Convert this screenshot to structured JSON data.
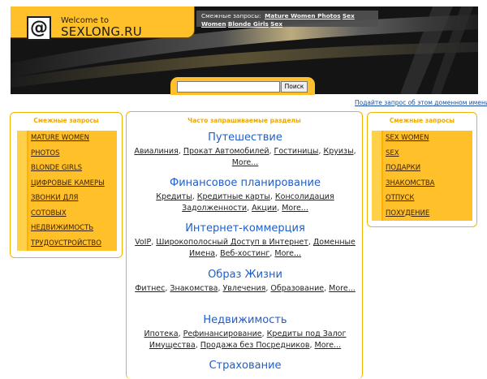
{
  "logo": {
    "welcome": "Welcome to",
    "site": "SEXLONG.RU",
    "icon": "at-icon"
  },
  "related_top": {
    "label": "Смежные запросы:",
    "links": [
      "Mature Women Photos",
      "Sex Women",
      "Blonde Girls",
      "Sex"
    ]
  },
  "search": {
    "value": "",
    "button": "Поиск"
  },
  "suggest_link": "Подайте запрос об этом доменном имени на",
  "left_panel": {
    "title": "Смежные запросы",
    "items": [
      "MATURE WOMEN",
      "PHOTOS",
      "BLONDE GIRLS",
      "ЦИФРОВЫЕ КАМЕРЫ",
      "ЗВОНКИ ДЛЯ",
      "СОТОВЫХ",
      "НЕДВИЖИМОСТЬ",
      "ТРУДОУСТРОЙСТВО"
    ]
  },
  "right_panel": {
    "title": "Смежные запросы",
    "items": [
      "SEX WOMEN",
      "SEX",
      "ПОДАРКИ",
      "ЗНАКОМСТВА",
      "ОТПУСК",
      "ПОХУДЕНИЕ"
    ]
  },
  "center": {
    "title": "Часто запрашиваемые разделы",
    "sections": [
      {
        "head": "Путешествие",
        "links": [
          "Авиалиния",
          "Прокат Автомобилей",
          "Гостиницы",
          "Круизы",
          "More..."
        ]
      },
      {
        "head": "Финансовое планирование",
        "links": [
          "Кредиты",
          "Кредитные карты",
          "Консолидация Задолженности",
          "Акции",
          "More..."
        ]
      },
      {
        "head": "Интернет-коммерция",
        "links": [
          "VoIP",
          "Широкополосный Доступ в Интернет",
          "Доменные Имена",
          "Веб-хостинг",
          "More..."
        ]
      },
      {
        "head": "Образ Жизни",
        "links": [
          "Фитнес",
          "Знакомства",
          "Увлечения",
          "Образование",
          "More..."
        ]
      },
      {
        "head": "Недвижимость",
        "links": [
          "Ипотека",
          "Рефинансирование",
          "Кредиты под Залог Имущества",
          "Продажа без Посредников",
          "More..."
        ]
      },
      {
        "head": "Страхование",
        "links": []
      }
    ]
  },
  "colors": {
    "accent": "#ffc02a",
    "header_bg": "#151515",
    "link_blue": "#1f5ec9"
  }
}
